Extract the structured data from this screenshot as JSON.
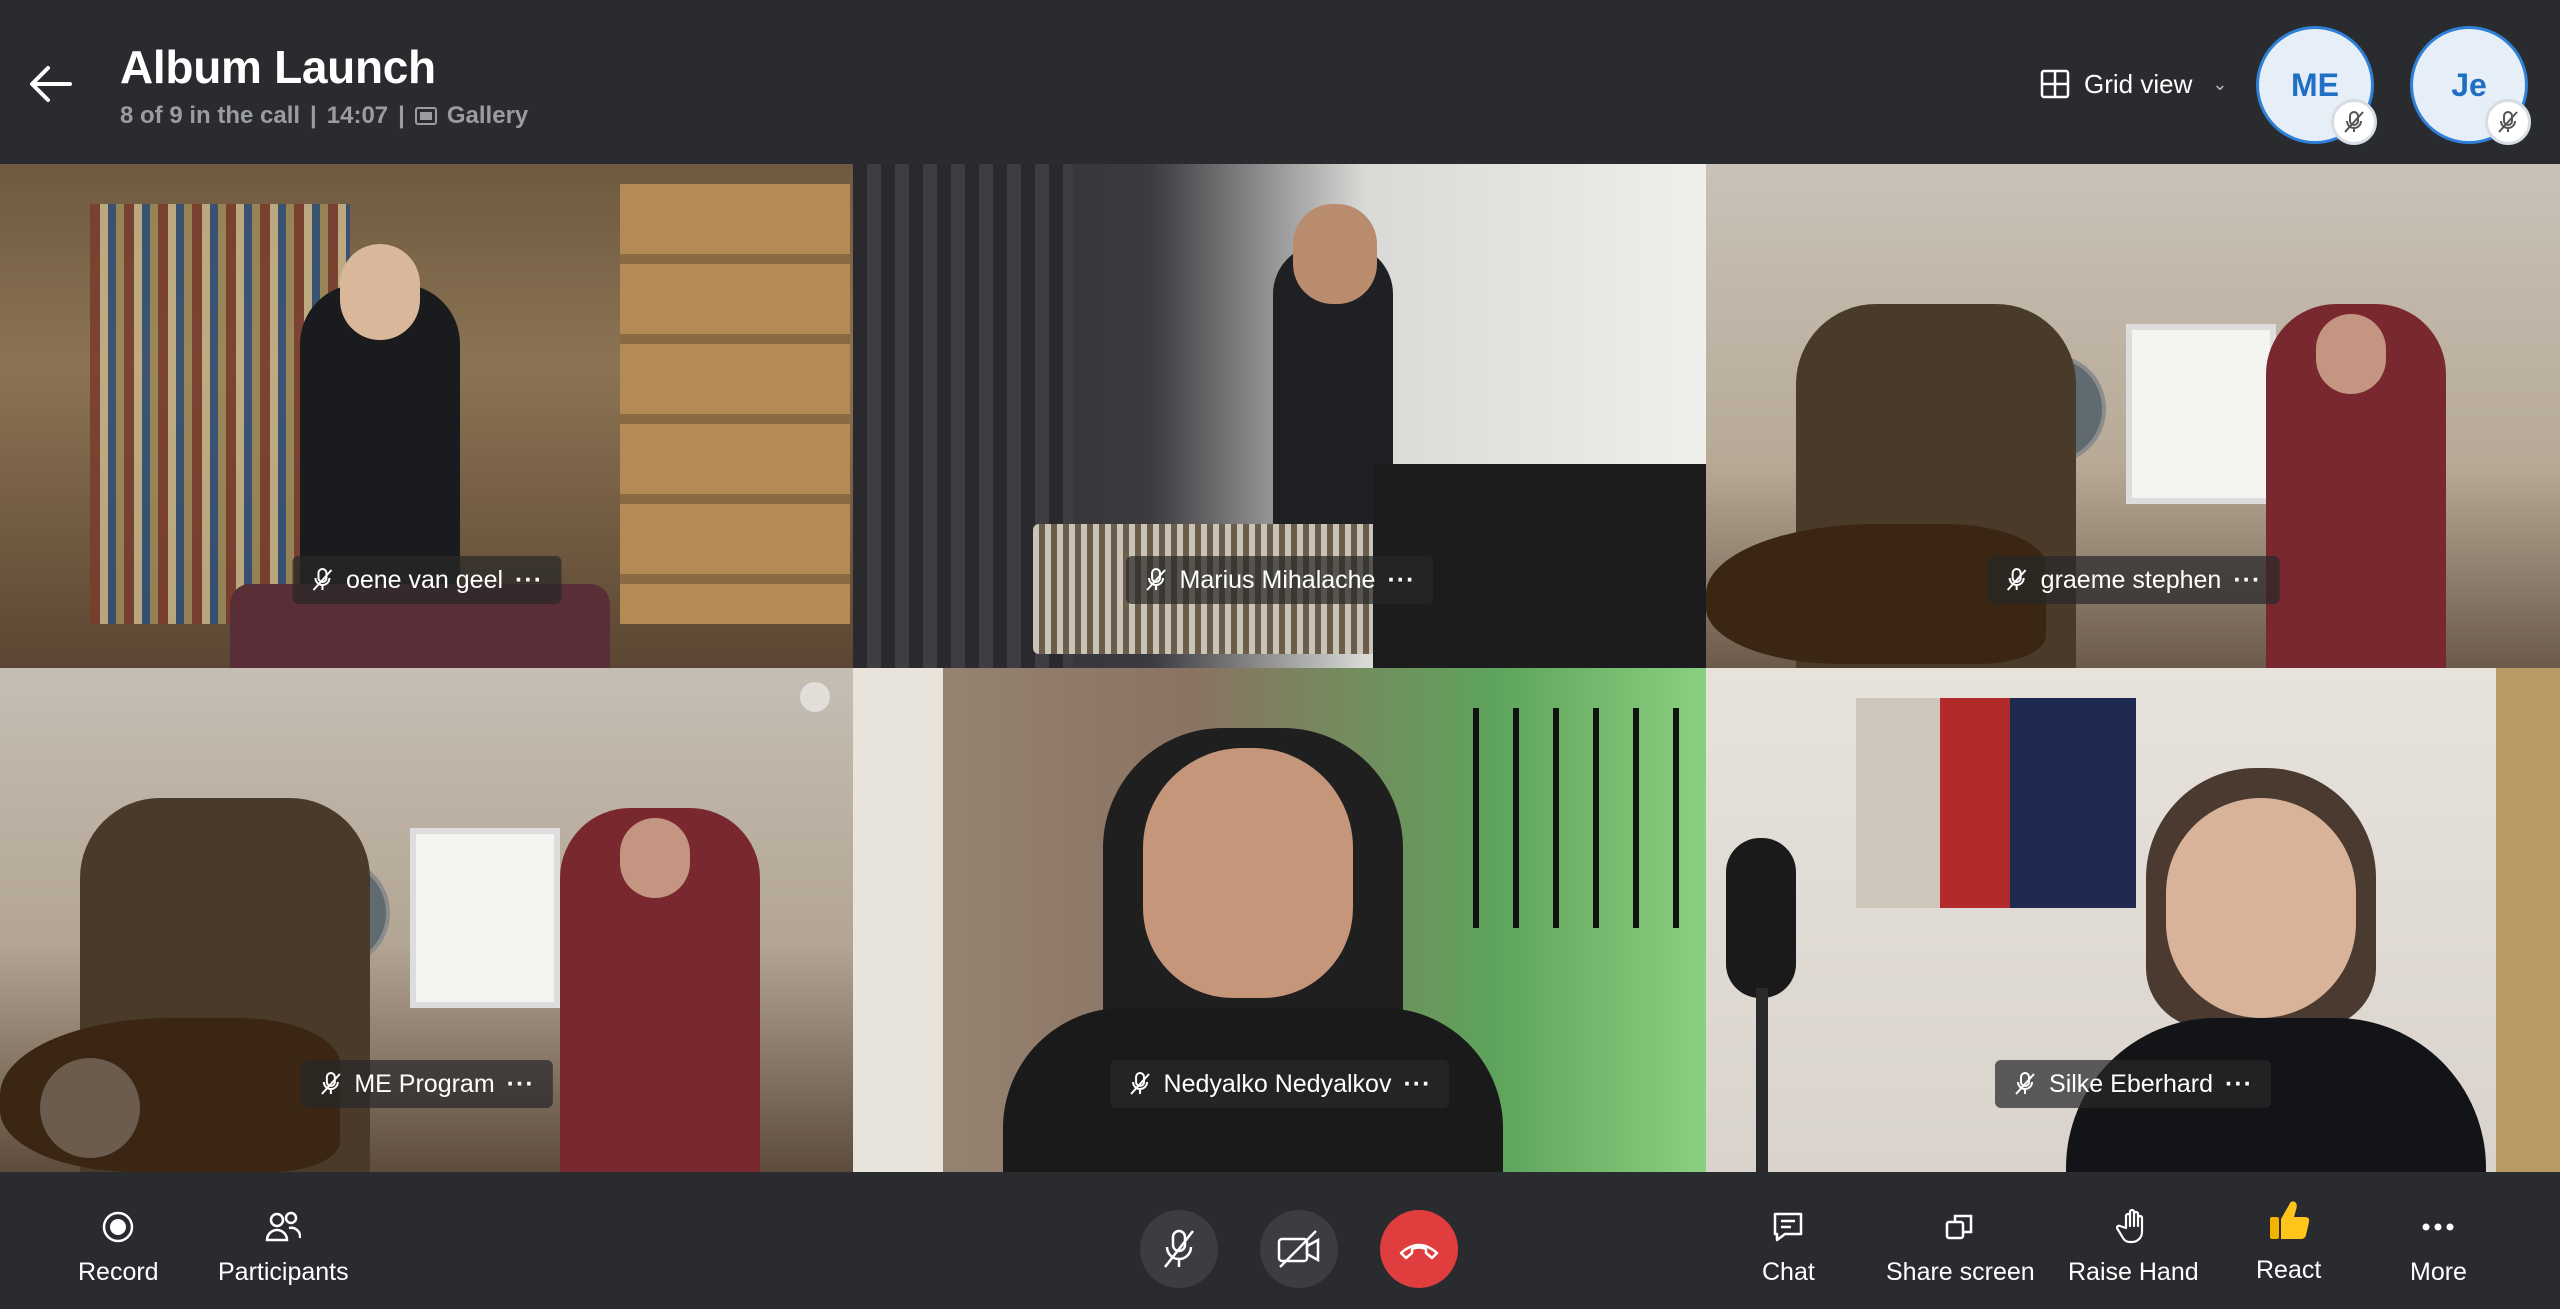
{
  "header": {
    "title": "Album Launch",
    "participants_text": "8 of 9 in the call",
    "time": "14:07",
    "view_label": "Gallery",
    "grid_view_label": "Grid view",
    "avatars": [
      {
        "initials": "ME",
        "muted": true
      },
      {
        "initials": "Je",
        "muted": true
      }
    ]
  },
  "tiles": [
    {
      "name": "oene van geel",
      "muted": true
    },
    {
      "name": "Marius Mihalache",
      "muted": true
    },
    {
      "name": "graeme stephen",
      "muted": true
    },
    {
      "name": "ME Program",
      "muted": true
    },
    {
      "name": "Nedyalko Nedyalkov",
      "muted": true
    },
    {
      "name": "Silke Eberhard",
      "muted": true
    }
  ],
  "toolbar": {
    "record_label": "Record",
    "participants_label": "Participants",
    "chat_label": "Chat",
    "share_label": "Share screen",
    "raise_hand_label": "Raise Hand",
    "react_label": "React",
    "more_label": "More",
    "more_glyph": "···"
  },
  "colors": {
    "background": "#292b2f",
    "accent": "#2f7fd6",
    "end_call": "#e03e3e"
  },
  "icons": [
    "back-arrow-icon",
    "gallery-icon",
    "grid-icon",
    "chevron-down-icon",
    "mic-off-icon",
    "camera-off-icon",
    "end-call-icon",
    "record-icon",
    "participants-icon",
    "chat-icon",
    "share-screen-icon",
    "raise-hand-icon",
    "thumbs-up-icon",
    "more-icon"
  ]
}
